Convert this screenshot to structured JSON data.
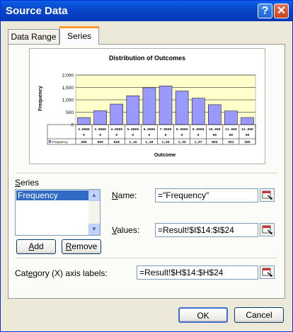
{
  "window": {
    "title": "Source Data",
    "help_glyph": "?",
    "close_glyph": "✕"
  },
  "tabs": [
    {
      "label": "Data Range"
    },
    {
      "label": "Series"
    }
  ],
  "chart_data": {
    "type": "bar",
    "title": "Distribution of Outcomes",
    "xlabel": "Outcome",
    "ylabel": "Frequency",
    "ylim": [
      0,
      2000
    ],
    "yticks": [
      "2,000",
      "1,500",
      "1,000",
      "500",
      "0"
    ],
    "categories": [
      "2.0000 0",
      "3.0000 0",
      "4.0000 0",
      "5.0000 0",
      "6.0000 0",
      "7.0000 0",
      "8.0000 0",
      "9.0000 0",
      "10.000 00",
      "11.000 00",
      "12.000 00"
    ],
    "series": [
      {
        "name": "Frequency",
        "values": [
          285,
          559,
          828,
          1164,
          1488,
          1560,
          1356,
          1067,
          804,
          551,
          285
        ]
      }
    ],
    "table_values": [
      "285",
      "559",
      "828",
      "1,16",
      "1,48",
      "1,56",
      "1,35",
      "1,07",
      "804",
      "551",
      "285"
    ],
    "colors": {
      "plot_bg": "#FFFFCC",
      "bar": "#9999FF"
    }
  },
  "series_section": {
    "label": "Series",
    "label_underline": "S",
    "label_rest": "eries",
    "items": [
      "Frequency"
    ],
    "add_button": {
      "underline": "A",
      "rest": "dd"
    },
    "remove_button": {
      "underline": "R",
      "rest": "emove"
    }
  },
  "name_field": {
    "label_u": "N",
    "label_rest": "ame:",
    "value": "=\"Frequency\""
  },
  "values_field": {
    "label_u": "V",
    "label_rest": "alues:",
    "value": "=Result!$I$14:$I$24"
  },
  "category_field": {
    "label_pre": "Cat",
    "label_u": "e",
    "label_rest": "gory (X) axis labels:",
    "value": "=Result!$H$14:$H$24"
  },
  "buttons": {
    "ok": "OK",
    "cancel": "Cancel"
  }
}
